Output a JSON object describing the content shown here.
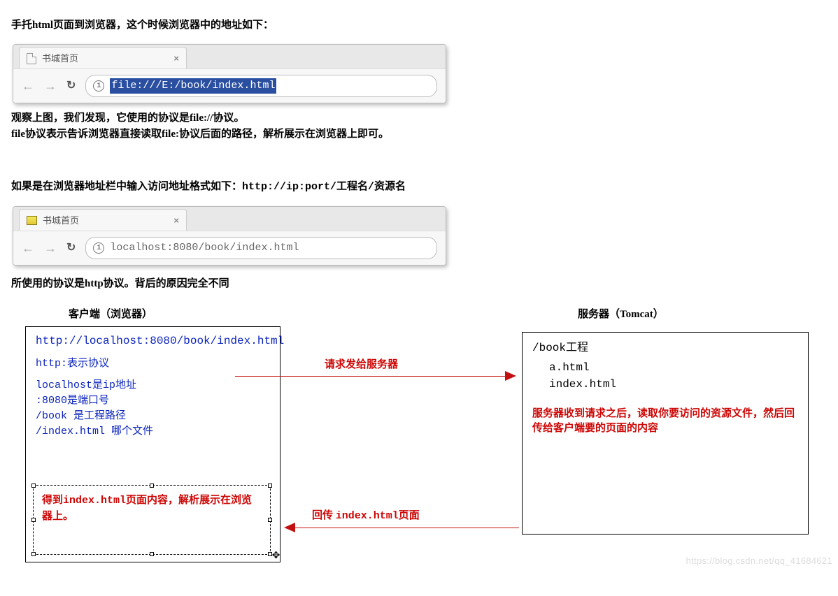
{
  "intro1": "手托html页面到浏览器，这个时候浏览器中的地址如下：",
  "browser1": {
    "tab_title": "书城首页",
    "close": "×",
    "url_display": "file:///E:/book/index.html"
  },
  "observe1": "观察上图，我们发现，它使用的协议是file://协议。",
  "observe2": "file协议表示告诉浏览器直接读取file:协议后面的路径，解析展示在浏览器上即可。",
  "intro2_a": "如果是在浏览器地址栏中输入访问地址格式如下：",
  "intro2_b": "http://ip:port/工程名/资源名",
  "browser2": {
    "tab_title": "书城首页",
    "close": "×",
    "url_display": "localhost:8080/book/index.html"
  },
  "observe3": "所使用的协议是http协议。背后的原因完全不同",
  "client": {
    "title": "客户端（浏览器）",
    "url": "http://localhost:8080/book/index.html",
    "lines": {
      "l1": "http:表示协议",
      "l2": "localhost是ip地址",
      "l3": ":8080是端口号",
      "l4": "/book 是工程路径",
      "l5": "/index.html 哪个文件"
    },
    "result_a": "得到",
    "result_b": "index.html",
    "result_c": "页面内容，解析展示在浏览器上。"
  },
  "server": {
    "title": "服务器（Tomcat）",
    "proj": "/book工程",
    "f1": "a.html",
    "f2": "index.html",
    "note": "服务器收到请求之后，读取你要访问的资源文件，然后回传给客户端要的页面的内容"
  },
  "arrows": {
    "req": "请求发给服务器",
    "resp_a": "回传 ",
    "resp_b": "index.html",
    "resp_c": "页面"
  },
  "watermark": "https://blog.csdn.net/qq_41684621"
}
